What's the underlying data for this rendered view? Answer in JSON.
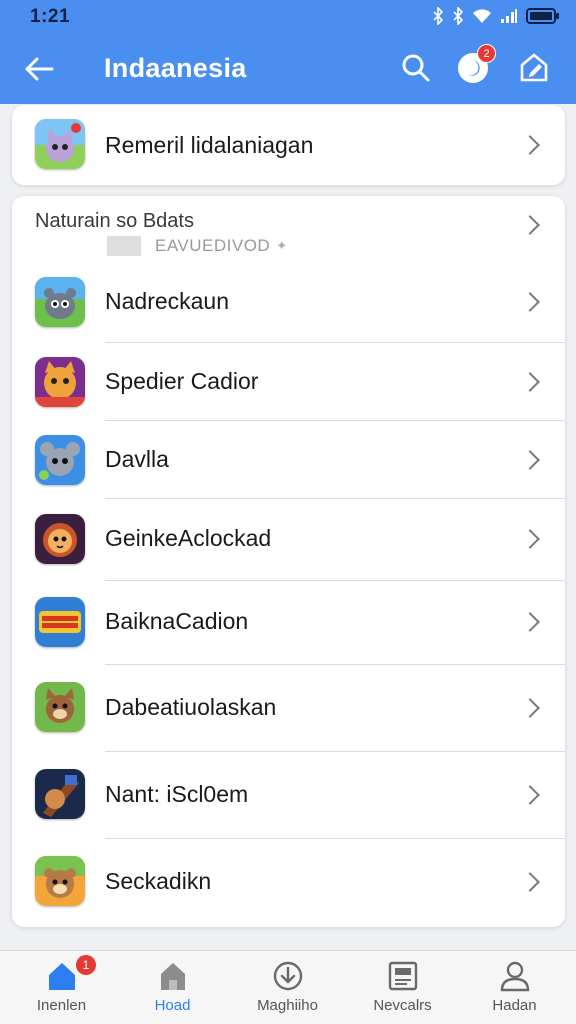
{
  "status_bar": {
    "time": "1:21"
  },
  "app_bar": {
    "title": "Indaanesia",
    "notification_count": "2"
  },
  "top_item": {
    "label": "Remeril lidalaniagan"
  },
  "section": {
    "title": "Naturain so Bdats",
    "subtitle": "EAVUEDIVOD",
    "items": [
      {
        "label": "Nadreckaun"
      },
      {
        "label": "Spedier Cadior"
      },
      {
        "label": "Davlla"
      },
      {
        "label": "GeinkeAclockad"
      },
      {
        "label": "BaiknaCadion"
      },
      {
        "label": "Dabeatiuolaskan"
      },
      {
        "label": "Nant: iScl0em"
      },
      {
        "label": "Seckadikn"
      }
    ]
  },
  "bottom_nav": {
    "items": [
      {
        "label": "Inenlen",
        "badge": "1"
      },
      {
        "label": "Hoad"
      },
      {
        "label": "Maghiiho"
      },
      {
        "label": "Nevcalrs"
      },
      {
        "label": "Hadan"
      }
    ],
    "active_index": 1
  },
  "colors": {
    "header": "#4a8ff0",
    "accent": "#2d7ff0",
    "badge": "#e53935"
  }
}
